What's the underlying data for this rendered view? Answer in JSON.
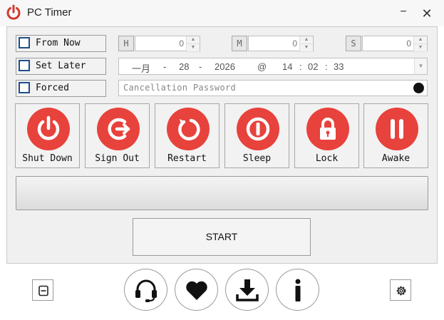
{
  "window": {
    "title": "PC Timer",
    "minimize_glyph": "−",
    "close_glyph": "✕"
  },
  "options": {
    "from_now": {
      "label": "From Now",
      "checked": false
    },
    "set_later": {
      "label": "Set Later",
      "checked": false
    },
    "forced": {
      "label": "Forced",
      "checked": false
    }
  },
  "duration": {
    "hours": {
      "unit": "H",
      "value": "0"
    },
    "minutes": {
      "unit": "M",
      "value": "0"
    },
    "seconds": {
      "unit": "S",
      "value": "0"
    }
  },
  "schedule": {
    "month": "一月",
    "sep1": "-",
    "day": "28",
    "sep2": "-",
    "year": "2026",
    "at": "@",
    "hour": "14",
    "colon1": ":",
    "minute": "02",
    "colon2": ":",
    "second": "33"
  },
  "password": {
    "placeholder": "Cancellation Password"
  },
  "actions": [
    {
      "label": "Shut Down",
      "icon": "power-icon"
    },
    {
      "label": "Sign Out",
      "icon": "sign-out-icon"
    },
    {
      "label": "Restart",
      "icon": "restart-icon"
    },
    {
      "label": "Sleep",
      "icon": "sleep-icon"
    },
    {
      "label": "Lock",
      "icon": "lock-icon"
    },
    {
      "label": "Awake",
      "icon": "pause-icon"
    }
  ],
  "start": {
    "label": "START"
  },
  "progress": {
    "value": 0
  },
  "colors": {
    "accent": "#e8423c",
    "panel": "#f0f0f0",
    "checkbox_border": "#1f4e8c"
  },
  "footer": {
    "left_icon": "window-icon",
    "buttons": [
      "headset-icon",
      "heart-icon",
      "download-icon",
      "info-icon"
    ],
    "right_icon": "gear-icon"
  }
}
